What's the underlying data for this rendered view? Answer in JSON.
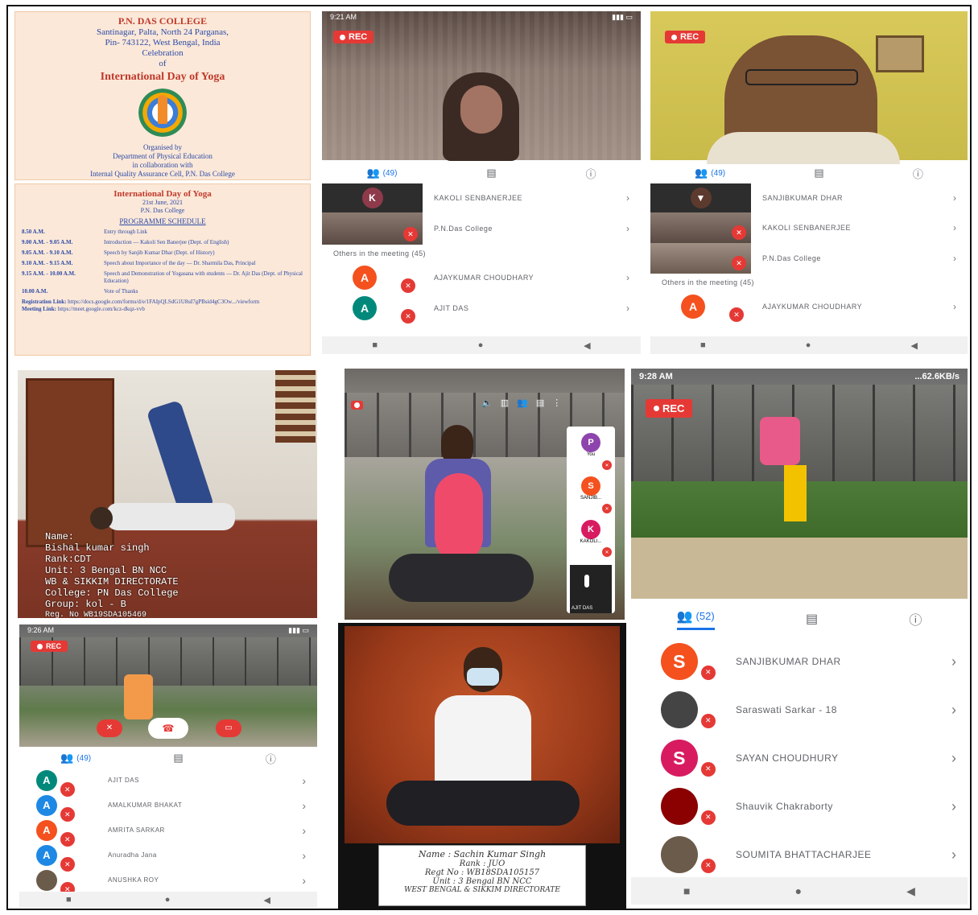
{
  "poster": {
    "college": "P.N. DAS COLLEGE",
    "address1": "Santinagar, Palta, North 24 Parganas,",
    "address2": "Pin- 743122, West Bengal, India",
    "celebration": "Celebration",
    "of": "of",
    "title": "International Day of Yoga",
    "organised_by": "Organised by",
    "dept": "Department of Physical Education",
    "collab": "in collaboration with",
    "iqac": "Internal Quality Assurance Cell, P.N. Das College",
    "schedule_title": "International Day of Yoga",
    "schedule_date": "21st June, 2021",
    "schedule_venue": "P.N. Das College",
    "schedule_heading": "PROGRAMME SCHEDULE",
    "rows": [
      {
        "time": "8.50 A.M.",
        "desc": "Entry through Link"
      },
      {
        "time": "9.00 A.M. - 9.05 A.M.",
        "desc": "Introduction — Kakoli Sen Banerjee (Dept. of English)"
      },
      {
        "time": "9.05 A.M. - 9.10 A.M.",
        "desc": "Speech by Sanjib Kumar Dhar (Dept. of History)"
      },
      {
        "time": "9.10 A.M. - 9.15 A.M.",
        "desc": "Speech about Importance of the day — Dr. Sharmila Das, Principal"
      },
      {
        "time": "9.15 A.M. - 10.00 A.M.",
        "desc": "Speech and Demonstration of Yogasana with students — Dr. Ajit Das (Dept. of Physical Education)"
      },
      {
        "time": "10.00 A.M.",
        "desc": "Vote of Thanks"
      }
    ],
    "registration_label": "Registration Link:",
    "registration_link": "https://docs.google.com/forms/d/e/1FAIpQLSdG1U8uI7gPBsid4gC3Ow.../viewform",
    "meeting_label": "Meeting Link:",
    "meeting_link": "https://meet.google.com/kcz-dkqz-vvb"
  },
  "call1": {
    "time": "9:21 AM",
    "rec": "REC",
    "count": "(49)",
    "participants": [
      "KAKOLI SENBANERJEE",
      "P.N.Das College"
    ],
    "others_label": "Others in the meeting (45)",
    "others": [
      {
        "initial": "A",
        "name": "AJAYKUMAR CHOUDHARY"
      },
      {
        "initial": "A",
        "name": "AJIT DAS"
      }
    ]
  },
  "call2": {
    "rec": "REC",
    "count": "(49)",
    "participants": [
      "SANJIBKUMAR DHAR",
      "KAKOLI SENBANERJEE",
      "P.N.Das College"
    ],
    "others_label": "Others in the meeting (45)",
    "others": [
      {
        "initial": "A",
        "name": "AJAYKUMAR CHOUDHARY"
      }
    ]
  },
  "photo1": {
    "lines": [
      "Name:",
      "Bishal kumar singh",
      "Rank:CDT",
      "Unit: 3 Bengal BN NCC",
      "WB & SIKKIM DIRECTORATE",
      "College: PN Das College",
      "Group: kol - B",
      "Reg. No WB19SDA105469"
    ]
  },
  "call3": {
    "tiles": [
      "P",
      "S",
      "K"
    ],
    "tile_labels": [
      "You",
      "SANJIB...",
      "KAKOLI..."
    ],
    "self_label": "AJIT DAS"
  },
  "call4": {
    "time": "9:28 AM",
    "network": "...62.6KB/s",
    "rec": "REC",
    "count": "(52)",
    "participants": [
      {
        "initial": "S",
        "name": "SANJIBKUMAR DHAR",
        "color": "#f4511e"
      },
      {
        "initial": "",
        "name": "Saraswati Sarkar - 18",
        "color": "#444444"
      },
      {
        "initial": "S",
        "name": "SAYAN CHOUDHURY",
        "color": "#d81b60"
      },
      {
        "initial": "",
        "name": "Shauvik Chakraborty",
        "color": "#8b0000"
      },
      {
        "initial": "",
        "name": "SOUMITA BHATTACHARJEE",
        "color": "#6b5b4b"
      }
    ]
  },
  "call5": {
    "time": "9:26 AM",
    "rec": "REC",
    "count": "(49)",
    "participants": [
      {
        "initial": "A",
        "name": "AJIT DAS",
        "color": "#00897b"
      },
      {
        "initial": "A",
        "name": "AMALKUMAR BHAKAT",
        "color": "#1e88e5"
      },
      {
        "initial": "A",
        "name": "AMRITA SARKAR",
        "color": "#f4511e"
      },
      {
        "initial": "A",
        "name": "Anuradha Jana",
        "color": "#1e88e5"
      },
      {
        "initial": "",
        "name": "ANUSHKA ROY",
        "color": "#6b5b4b"
      }
    ]
  },
  "photo2": {
    "lines": [
      "Name : Sachin Kumar Singh",
      "Rank : JUO",
      "Regt No : WB18SDA105157",
      "Unit : 3 Bengal BN NCC",
      "WEST BENGAL & SIKKIM DIRECTORATE"
    ]
  }
}
